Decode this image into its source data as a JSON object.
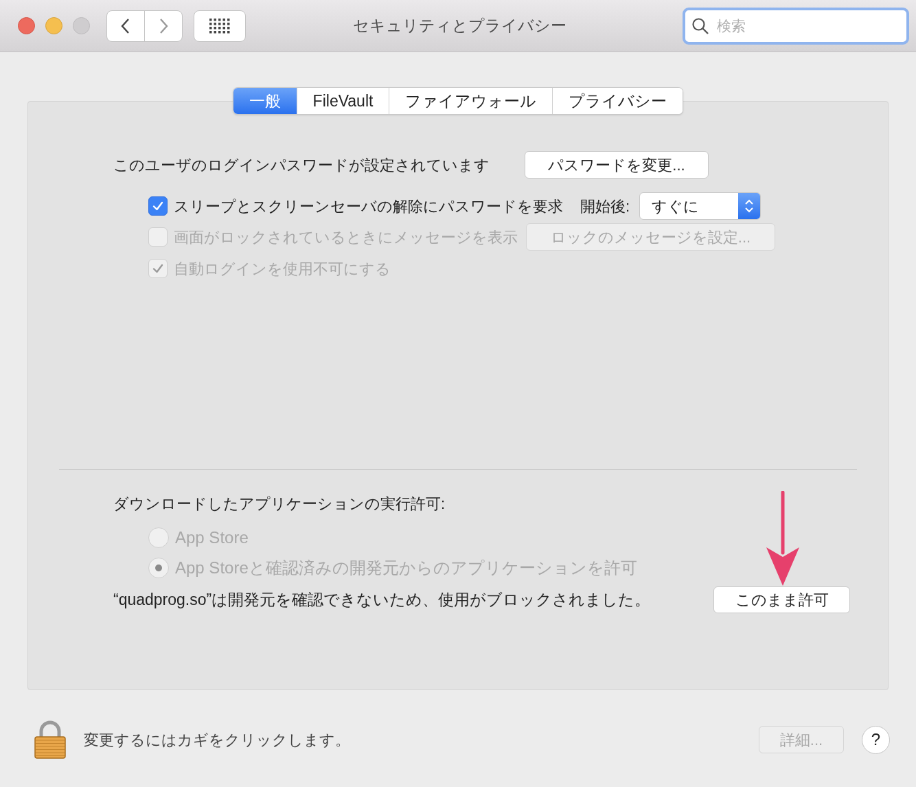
{
  "window": {
    "title": "セキュリティとプライバシー"
  },
  "search": {
    "placeholder": "検索"
  },
  "tabs": [
    {
      "label": "一般",
      "selected": true
    },
    {
      "label": "FileVault",
      "selected": false
    },
    {
      "label": "ファイアウォール",
      "selected": false
    },
    {
      "label": "プライバシー",
      "selected": false
    }
  ],
  "login": {
    "text": "このユーザのログインパスワードが設定されています",
    "button": "パスワードを変更..."
  },
  "options": [
    {
      "label": "スリープとスクリーンセーバの解除にパスワードを要求",
      "checked": true,
      "disabled": false,
      "after_label": "開始後:",
      "select": "すぐに"
    },
    {
      "label": "画面がロックされているときにメッセージを表示",
      "checked": false,
      "disabled": true,
      "button": "ロックのメッセージを設定..."
    },
    {
      "label": "自動ログインを使用不可にする",
      "checked": true,
      "disabled": true
    }
  ],
  "downloads": {
    "heading": "ダウンロードしたアプリケーションの実行許可:",
    "radios": [
      {
        "label": "App Store",
        "selected": false,
        "disabled": true
      },
      {
        "label": "App Storeと確認済みの開発元からのアプリケーションを許可",
        "selected": true,
        "disabled": true
      }
    ],
    "blocked_message": "“quadprog.so”は開発元を確認できないため、使用がブロックされました。",
    "allow_button": "このまま許可"
  },
  "footer": {
    "lock_text": "変更するにはカギをクリックします。",
    "details_button": {
      "label": "詳細...",
      "disabled": true
    },
    "help": "?"
  }
}
